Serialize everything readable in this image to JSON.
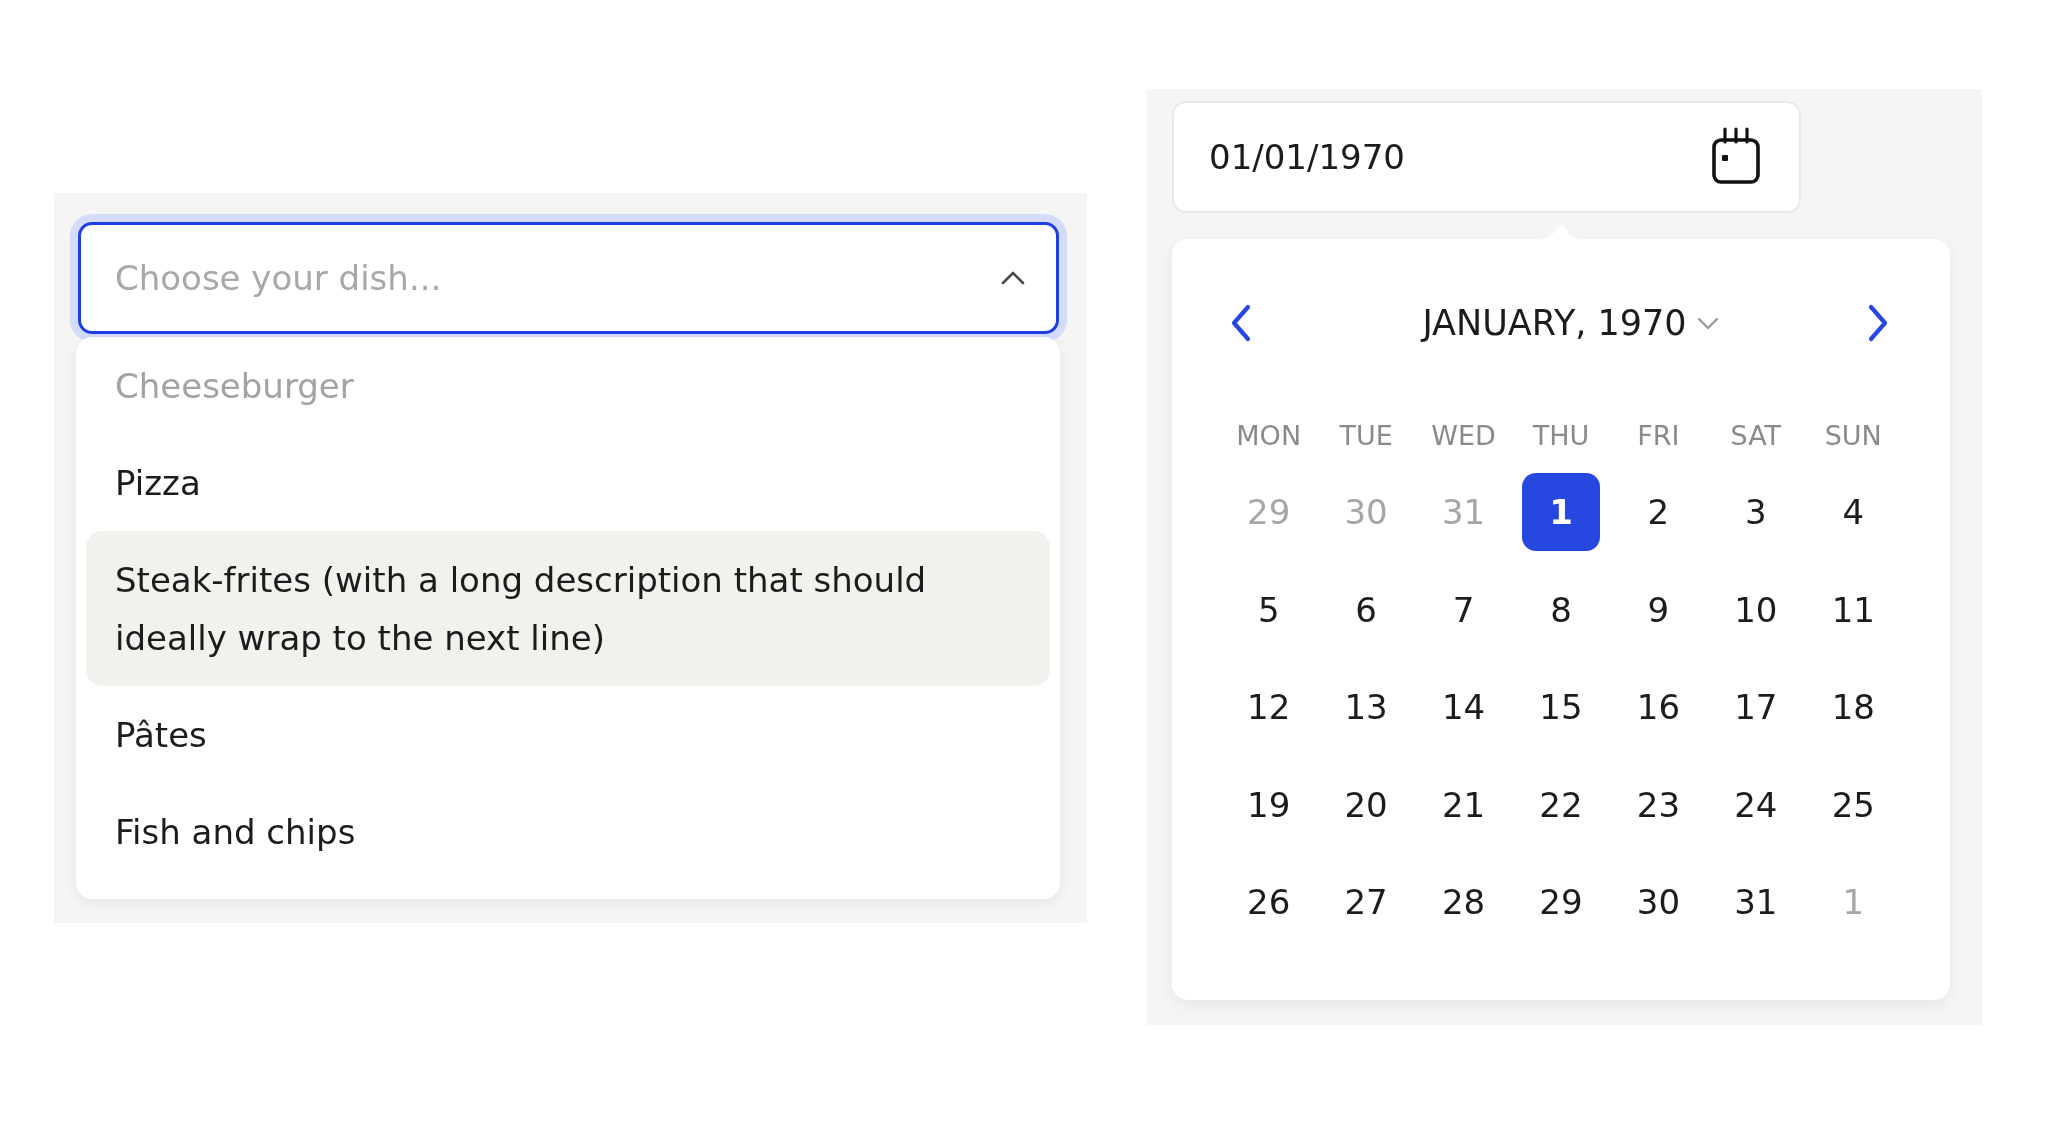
{
  "dish_select": {
    "placeholder": "Choose your dish...",
    "focused": true,
    "expanded": true,
    "options": [
      {
        "label": "Cheeseburger",
        "disabled": true,
        "highlighted": false
      },
      {
        "label": "Pizza",
        "disabled": false,
        "highlighted": false
      },
      {
        "label": "Steak-frites (with a long description that should ideally wrap to the next line)",
        "disabled": false,
        "highlighted": true
      },
      {
        "label": "Pâtes",
        "disabled": false,
        "highlighted": false
      },
      {
        "label": "Fish and chips",
        "disabled": false,
        "highlighted": false
      }
    ]
  },
  "date_picker": {
    "value": "01/01/1970",
    "calendar": {
      "month_label": "JANUARY, 1970",
      "weekdays": [
        "MON",
        "TUE",
        "WED",
        "THU",
        "FRI",
        "SAT",
        "SUN"
      ],
      "weeks": [
        [
          {
            "day": "29",
            "outside": true,
            "selected": false
          },
          {
            "day": "30",
            "outside": true,
            "selected": false
          },
          {
            "day": "31",
            "outside": true,
            "selected": false
          },
          {
            "day": "1",
            "outside": false,
            "selected": true
          },
          {
            "day": "2",
            "outside": false,
            "selected": false
          },
          {
            "day": "3",
            "outside": false,
            "selected": false
          },
          {
            "day": "4",
            "outside": false,
            "selected": false
          }
        ],
        [
          {
            "day": "5",
            "outside": false,
            "selected": false
          },
          {
            "day": "6",
            "outside": false,
            "selected": false
          },
          {
            "day": "7",
            "outside": false,
            "selected": false
          },
          {
            "day": "8",
            "outside": false,
            "selected": false
          },
          {
            "day": "9",
            "outside": false,
            "selected": false
          },
          {
            "day": "10",
            "outside": false,
            "selected": false
          },
          {
            "day": "11",
            "outside": false,
            "selected": false
          }
        ],
        [
          {
            "day": "12",
            "outside": false,
            "selected": false
          },
          {
            "day": "13",
            "outside": false,
            "selected": false
          },
          {
            "day": "14",
            "outside": false,
            "selected": false
          },
          {
            "day": "15",
            "outside": false,
            "selected": false
          },
          {
            "day": "16",
            "outside": false,
            "selected": false
          },
          {
            "day": "17",
            "outside": false,
            "selected": false
          },
          {
            "day": "18",
            "outside": false,
            "selected": false
          }
        ],
        [
          {
            "day": "19",
            "outside": false,
            "selected": false
          },
          {
            "day": "20",
            "outside": false,
            "selected": false
          },
          {
            "day": "21",
            "outside": false,
            "selected": false
          },
          {
            "day": "22",
            "outside": false,
            "selected": false
          },
          {
            "day": "23",
            "outside": false,
            "selected": false
          },
          {
            "day": "24",
            "outside": false,
            "selected": false
          },
          {
            "day": "25",
            "outside": false,
            "selected": false
          }
        ],
        [
          {
            "day": "26",
            "outside": false,
            "selected": false
          },
          {
            "day": "27",
            "outside": false,
            "selected": false
          },
          {
            "day": "28",
            "outside": false,
            "selected": false
          },
          {
            "day": "29",
            "outside": false,
            "selected": false
          },
          {
            "day": "30",
            "outside": false,
            "selected": false
          },
          {
            "day": "31",
            "outside": false,
            "selected": false
          },
          {
            "day": "1",
            "outside": true,
            "selected": false
          }
        ]
      ]
    }
  }
}
